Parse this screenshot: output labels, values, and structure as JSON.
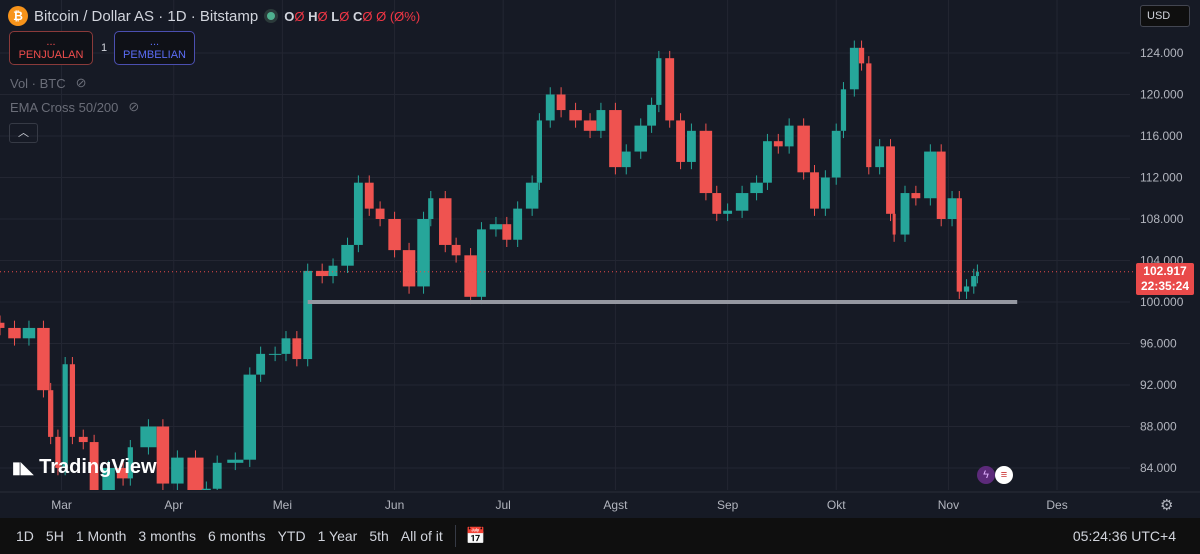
{
  "header": {
    "symbol": "Bitcoin / Dollar AS · 1D · Bitstamp",
    "coin_glyph": "₿",
    "ohlc": [
      {
        "k": "O",
        "v": "Ø"
      },
      {
        "k": "H",
        "v": "Ø"
      },
      {
        "k": "L",
        "v": "Ø"
      },
      {
        "k": "C",
        "v": "Ø"
      }
    ],
    "change": "Ø (Ø%)"
  },
  "trade": {
    "sell_price": "...",
    "sell_label": "PENJUALAN",
    "qty": "1",
    "buy_price": "...",
    "buy_label": "PEMBELIAN"
  },
  "indicators": [
    {
      "label": "Vol · BTC",
      "icon": "eye-off-icon"
    },
    {
      "label": "EMA Cross 50/200",
      "icon": "eye-off-icon"
    }
  ],
  "currency": "USD",
  "price_tag": {
    "price": "102.917",
    "countdown": "22:35:24"
  },
  "logo": "TradingView",
  "bottom": {
    "ranges": [
      "1D",
      "5H",
      "1 Month",
      "3 months",
      "6 months",
      "YTD",
      "1 Year",
      "5th",
      "All of it"
    ],
    "clock": "05:24:36 UTC+4"
  },
  "colors": {
    "up": "#26a69a",
    "down": "#ef5350",
    "bg": "#161a25",
    "line": "#9598a1",
    "price": "#e94a4a"
  },
  "chart_data": {
    "type": "candlestick",
    "title": "",
    "xlabel": "",
    "ylabel": "",
    "ylim": [
      82000,
      126000
    ],
    "grid": true,
    "yticks": [
      {
        "v": 84000,
        "l": "84.000"
      },
      {
        "v": 88000,
        "l": "88.000"
      },
      {
        "v": 92000,
        "l": "92.000"
      },
      {
        "v": 96000,
        "l": "96.000"
      },
      {
        "v": 100000,
        "l": "100.000"
      },
      {
        "v": 104000,
        "l": "104.000"
      },
      {
        "v": 108000,
        "l": "108.000"
      },
      {
        "v": 112000,
        "l": "112.000"
      },
      {
        "v": 116000,
        "l": "116.000"
      },
      {
        "v": 120000,
        "l": "120.000"
      },
      {
        "v": 124000,
        "l": "124.000"
      }
    ],
    "xticks": [
      {
        "d": "2025-03-01",
        "l": "Mar"
      },
      {
        "d": "2025-04-01",
        "l": "Apr"
      },
      {
        "d": "2025-05-01",
        "l": "Mei"
      },
      {
        "d": "2025-06-01",
        "l": "Jun"
      },
      {
        "d": "2025-07-01",
        "l": "Jul"
      },
      {
        "d": "2025-08-01",
        "l": "Agst"
      },
      {
        "d": "2025-09-01",
        "l": "Sep"
      },
      {
        "d": "2025-10-01",
        "l": "Okt"
      },
      {
        "d": "2025-11-01",
        "l": "Nov"
      },
      {
        "d": "2025-12-01",
        "l": "Des"
      }
    ],
    "xrange": [
      "2025-02-12",
      "2025-12-20"
    ],
    "closes": [
      [
        "2025-02-12",
        97500
      ],
      [
        "2025-02-16",
        96500
      ],
      [
        "2025-02-20",
        97500
      ],
      [
        "2025-02-24",
        91500
      ],
      [
        "2025-02-26",
        87000
      ],
      [
        "2025-02-28",
        84000
      ],
      [
        "2025-03-02",
        94000
      ],
      [
        "2025-03-04",
        87000
      ],
      [
        "2025-03-07",
        86500
      ],
      [
        "2025-03-10",
        80000
      ],
      [
        "2025-03-14",
        84000
      ],
      [
        "2025-03-18",
        83000
      ],
      [
        "2025-03-20",
        86000
      ],
      [
        "2025-03-25",
        88000
      ],
      [
        "2025-03-29",
        82500
      ],
      [
        "2025-04-02",
        85000
      ],
      [
        "2025-04-07",
        79000
      ],
      [
        "2025-04-10",
        82000
      ],
      [
        "2025-04-13",
        84500
      ],
      [
        "2025-04-18",
        84800
      ],
      [
        "2025-04-22",
        93000
      ],
      [
        "2025-04-25",
        95000
      ],
      [
        "2025-04-29",
        95000
      ],
      [
        "2025-05-02",
        96500
      ],
      [
        "2025-05-05",
        94500
      ],
      [
        "2025-05-08",
        103000
      ],
      [
        "2025-05-12",
        102500
      ],
      [
        "2025-05-15",
        103500
      ],
      [
        "2025-05-19",
        105500
      ],
      [
        "2025-05-22",
        111500
      ],
      [
        "2025-05-25",
        109000
      ],
      [
        "2025-05-28",
        108000
      ],
      [
        "2025-06-01",
        105000
      ],
      [
        "2025-06-05",
        101500
      ],
      [
        "2025-06-09",
        108000
      ],
      [
        "2025-06-11",
        110000
      ],
      [
        "2025-06-15",
        105500
      ],
      [
        "2025-06-18",
        104500
      ],
      [
        "2025-06-22",
        100500
      ],
      [
        "2025-06-25",
        107000
      ],
      [
        "2025-06-29",
        107500
      ],
      [
        "2025-07-02",
        106000
      ],
      [
        "2025-07-05",
        109000
      ],
      [
        "2025-07-09",
        111500
      ],
      [
        "2025-07-11",
        117500
      ],
      [
        "2025-07-14",
        120000
      ],
      [
        "2025-07-17",
        118500
      ],
      [
        "2025-07-21",
        117500
      ],
      [
        "2025-07-25",
        116500
      ],
      [
        "2025-07-28",
        118500
      ],
      [
        "2025-08-01",
        113000
      ],
      [
        "2025-08-04",
        114500
      ],
      [
        "2025-08-08",
        117000
      ],
      [
        "2025-08-11",
        119000
      ],
      [
        "2025-08-13",
        123500
      ],
      [
        "2025-08-16",
        117500
      ],
      [
        "2025-08-19",
        113500
      ],
      [
        "2025-08-22",
        116500
      ],
      [
        "2025-08-26",
        110500
      ],
      [
        "2025-08-29",
        108500
      ],
      [
        "2025-09-01",
        108800
      ],
      [
        "2025-09-05",
        110500
      ],
      [
        "2025-09-09",
        111500
      ],
      [
        "2025-09-12",
        115500
      ],
      [
        "2025-09-15",
        115000
      ],
      [
        "2025-09-18",
        117000
      ],
      [
        "2025-09-22",
        112500
      ],
      [
        "2025-09-25",
        109000
      ],
      [
        "2025-09-28",
        112000
      ],
      [
        "2025-10-01",
        116500
      ],
      [
        "2025-10-03",
        120500
      ],
      [
        "2025-10-06",
        124500
      ],
      [
        "2025-10-08",
        123000
      ],
      [
        "2025-10-10",
        113000
      ],
      [
        "2025-10-13",
        115000
      ],
      [
        "2025-10-16",
        108500
      ],
      [
        "2025-10-17",
        106500
      ],
      [
        "2025-10-20",
        110500
      ],
      [
        "2025-10-23",
        110000
      ],
      [
        "2025-10-27",
        114500
      ],
      [
        "2025-10-30",
        108000
      ],
      [
        "2025-11-02",
        110000
      ],
      [
        "2025-11-04",
        101000
      ],
      [
        "2025-11-06",
        101500
      ],
      [
        "2025-11-08",
        102500
      ],
      [
        "2025-11-09",
        102917
      ]
    ],
    "hline": {
      "value": 100000,
      "from": "2025-05-08",
      "to": "2025-11-20"
    },
    "last_price": 102917
  }
}
